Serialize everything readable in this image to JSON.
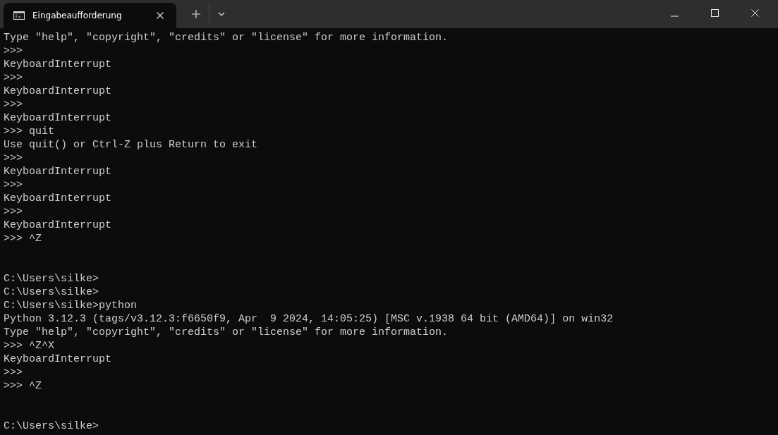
{
  "tabs": [
    {
      "title": "Eingabeaufforderung",
      "selected": true
    }
  ],
  "lines": [
    {
      "kind": "text",
      "text": "Type \"help\", \"copyright\", \"credits\" or \"license\" for more information."
    },
    {
      "kind": "text",
      "text": ">>>"
    },
    {
      "kind": "text",
      "text": "KeyboardInterrupt"
    },
    {
      "kind": "text",
      "text": ">>>"
    },
    {
      "kind": "text",
      "text": "KeyboardInterrupt"
    },
    {
      "kind": "text",
      "text": ">>>"
    },
    {
      "kind": "text",
      "text": "KeyboardInterrupt"
    },
    {
      "kind": "text",
      "text": ">>> quit"
    },
    {
      "kind": "text",
      "text": "Use quit() or Ctrl-Z plus Return to exit"
    },
    {
      "kind": "text",
      "text": ">>>"
    },
    {
      "kind": "text",
      "text": "KeyboardInterrupt"
    },
    {
      "kind": "text",
      "text": ">>>"
    },
    {
      "kind": "text",
      "text": "KeyboardInterrupt"
    },
    {
      "kind": "text",
      "text": ">>>"
    },
    {
      "kind": "text",
      "text": "KeyboardInterrupt"
    },
    {
      "kind": "text",
      "text": ">>> ^Z"
    },
    {
      "kind": "blank"
    },
    {
      "kind": "blank"
    },
    {
      "kind": "text",
      "text": "C:\\Users\\silke>"
    },
    {
      "kind": "text",
      "text": "C:\\Users\\silke>"
    },
    {
      "kind": "text",
      "text": "C:\\Users\\silke>python"
    },
    {
      "kind": "text",
      "text": "Python 3.12.3 (tags/v3.12.3:f6650f9, Apr  9 2024, 14:05:25) [MSC v.1938 64 bit (AMD64)] on win32"
    },
    {
      "kind": "text",
      "text": "Type \"help\", \"copyright\", \"credits\" or \"license\" for more information."
    },
    {
      "kind": "text",
      "text": ">>> ^Z^X"
    },
    {
      "kind": "text",
      "text": "KeyboardInterrupt"
    },
    {
      "kind": "text",
      "text": ">>>"
    },
    {
      "kind": "text",
      "text": ">>> ^Z"
    },
    {
      "kind": "blank"
    },
    {
      "kind": "blank"
    },
    {
      "kind": "text",
      "text": "C:\\Users\\silke>"
    }
  ]
}
